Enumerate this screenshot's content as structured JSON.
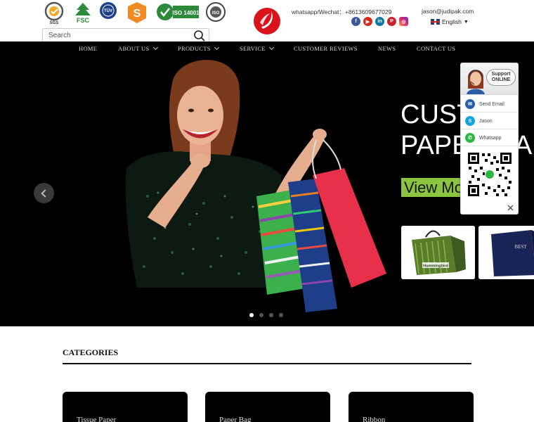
{
  "header": {
    "certifications": [
      "SGS",
      "FSC",
      "TÜV",
      "S",
      "ISO 14001",
      "ISO"
    ],
    "search": {
      "placeholder": "Search"
    },
    "whatsapp_line": "whatsapp/Wechat：+8613609677029",
    "email": "jason@judipak.com",
    "socials": [
      "facebook",
      "youtube",
      "linkedin",
      "pinterest",
      "instagram"
    ],
    "language": "English"
  },
  "nav": {
    "items": [
      {
        "label": "HOME",
        "dropdown": false
      },
      {
        "label": "ABOUT US",
        "dropdown": true
      },
      {
        "label": "PRODUCTS",
        "dropdown": true
      },
      {
        "label": "SERVICE",
        "dropdown": true
      },
      {
        "label": "CUSTOMER REVIEWS",
        "dropdown": false
      },
      {
        "label": "NEWS",
        "dropdown": false
      },
      {
        "label": "CONTACT US",
        "dropdown": false
      }
    ]
  },
  "hero": {
    "title": "CUST\nPAPER BA",
    "button": "View Mo",
    "thumbnails": [
      {
        "brand": "Hummingbird",
        "color": "#5a7d2c"
      },
      {
        "brand": "BEST",
        "color": "#1a2456"
      }
    ],
    "slides": 4,
    "active_slide": 1
  },
  "support": {
    "title_line1": "Support",
    "title_line2": "ONLINE",
    "items": [
      {
        "label": "Send Email",
        "icon": "email-icon",
        "color": "#2a5ea8"
      },
      {
        "label": "Jason",
        "icon": "skype-icon",
        "color": "#12a4e3"
      },
      {
        "label": "Whatsapp",
        "icon": "whatsapp-icon",
        "color": "#2cb742"
      }
    ]
  },
  "categories": {
    "title": "CATEGORIES",
    "cards": [
      "Tissue Paper",
      "Paper Bag",
      "Ribbon"
    ]
  }
}
